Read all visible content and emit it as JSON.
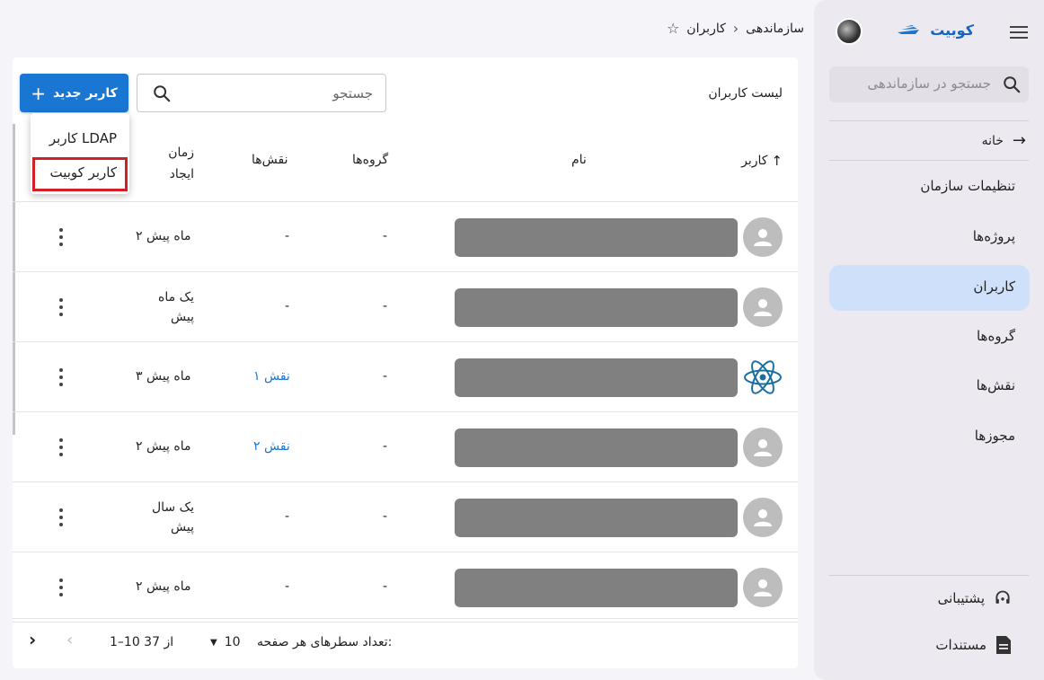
{
  "breadcrumb": {
    "org": "سازماندهی",
    "page": "کاربران"
  },
  "sidebar": {
    "brand": "کوبیت",
    "search_placeholder": "جستجو در سازماندهی",
    "home": "خانه",
    "items": [
      {
        "label": "تنظیمات سازمان",
        "active": false
      },
      {
        "label": "پروژه‌ها",
        "active": false
      },
      {
        "label": "کاربران",
        "active": true
      },
      {
        "label": "گروه‌ها",
        "active": false
      },
      {
        "label": "نقش‌ها",
        "active": false
      },
      {
        "label": "مجوزها",
        "active": false
      }
    ],
    "support": "پشتیبانی",
    "docs": "مستندات",
    "accent": "#cfe0fb"
  },
  "main": {
    "title": "لیست کاربران",
    "search_placeholder": "جستجو",
    "new_button": "کاربر جدید",
    "menu": {
      "ldap": "کاربر LDAP",
      "kubit": "کاربر کوبیت"
    },
    "columns": {
      "user": "کاربر",
      "name": "نام",
      "groups": "گروه‌ها",
      "roles": "نقش‌ها",
      "created_line1": "زمان",
      "created_line2": "ایجاد"
    },
    "rows": [
      {
        "avatar": "person",
        "groups": "-",
        "roles": "-",
        "roles_link": false,
        "created": "۲ ماه پیش",
        "created2": ""
      },
      {
        "avatar": "person",
        "groups": "-",
        "roles": "-",
        "roles_link": false,
        "created": "یک ماه",
        "created2": "پیش"
      },
      {
        "avatar": "react",
        "groups": "-",
        "roles": "۱ نقش",
        "roles_link": true,
        "created": "۳ ماه پیش",
        "created2": ""
      },
      {
        "avatar": "person",
        "groups": "-",
        "roles": "۲ نقش",
        "roles_link": true,
        "created": "۲ ماه پیش",
        "created2": ""
      },
      {
        "avatar": "person",
        "groups": "-",
        "roles": "-",
        "roles_link": false,
        "created": "یک سال",
        "created2": "پیش"
      },
      {
        "avatar": "person",
        "groups": "-",
        "roles": "-",
        "roles_link": false,
        "created": "۲ ماه پیش",
        "created2": ""
      }
    ],
    "footer": {
      "rows_per_page_label": "تعداد سطرهای هر صفحه:",
      "rows_per_page": "10",
      "range": "1–10 از 37"
    }
  },
  "colors": {
    "primary": "#1976d2",
    "highlight": "#d32027"
  }
}
